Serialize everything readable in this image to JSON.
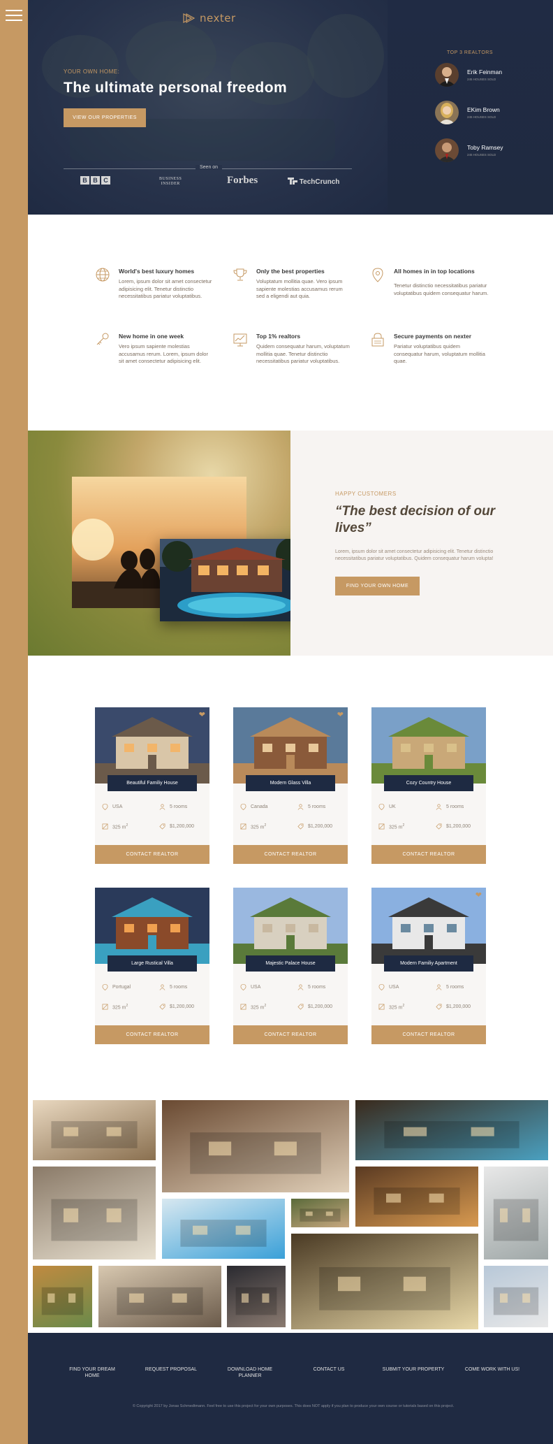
{
  "header": {
    "logo": "nexter",
    "subtitle": "YOUR OWN HOME:",
    "title": "The ultimate personal freedom",
    "cta": "VIEW OUR PROPERTIES",
    "seen_on": "Seen on",
    "brands": {
      "bbc": [
        "B",
        "B",
        "C"
      ],
      "business_insider": "BUSINESS\nINSIDER",
      "forbes": "Forbes",
      "techcrunch": "TechCrunch"
    }
  },
  "realtors": {
    "title": "TOP 3 REALTORS",
    "items": [
      {
        "name": "Erik Feinman",
        "sold": "245 HOUSES SOLD"
      },
      {
        "name": "EKim Brown",
        "sold": "245 HOUSES SOLD"
      },
      {
        "name": "Toby Ramsey",
        "sold": "245 HOUSES SOLD"
      }
    ]
  },
  "features": [
    {
      "icon": "globe-icon",
      "title": "World's best luxury homes",
      "text": "Lorem, ipsum dolor sit amet consectetur adipisicing elit. Tenetur distinctio necessitatibus pariatur voluptatibus."
    },
    {
      "icon": "trophy-icon",
      "title": "Only the best properties",
      "text": "Voluptatum mollitia quae. Vero ipsum sapiente molestias accusamus rerum sed a eligendi aut quia."
    },
    {
      "icon": "map-pin-icon",
      "title": "All homes in in top locations",
      "text": "Tenetur distinctio necessitatibus pariatur voluptatibus quidem consequatur harum."
    },
    {
      "icon": "key-icon",
      "title": "New home in one week",
      "text": "Vero ipsum sapiente molestias accusamus rerum. Lorem, ipsum dolor sit amet consectetur adipisicing elit."
    },
    {
      "icon": "chart-icon",
      "title": "Top 1% realtors",
      "text": "Quidem consequatur harum, voluptatum mollitia quae. Tenetur distinctio necessitatibus pariatur voluptatibus."
    },
    {
      "icon": "lock-icon",
      "title": "Secure payments on nexter",
      "text": "Pariatur voluptatibus quidem consequatur harum, voluptatum mollitia quae."
    }
  ],
  "story": {
    "label": "HAPPY CUSTOMERS",
    "quote": "“The best decision of our lives”",
    "text": "Lorem, ipsum dolor sit amet consectetur adipisicing elit. Tenetur distinctio necessitatibus pariatur voluptatibus. Quidem consequatur harum volupta!",
    "cta": "FIND YOUR OWN HOME"
  },
  "homes": [
    {
      "name": "Beautiful Familiy House",
      "country": "USA",
      "rooms": "5 rooms",
      "area": "325 m",
      "price": "$1,200,000",
      "cta": "CONTACT REALTOR",
      "favorite": true
    },
    {
      "name": "Modern Glass Villa",
      "country": "Canada",
      "rooms": "5 rooms",
      "area": "325 m",
      "price": "$1,200,000",
      "cta": "CONTACT REALTOR",
      "favorite": true
    },
    {
      "name": "Cozy Country House",
      "country": "UK",
      "rooms": "5 rooms",
      "area": "325 m",
      "price": "$1,200,000",
      "cta": "CONTACT REALTOR",
      "favorite": false
    },
    {
      "name": "Large Rustical Villa",
      "country": "Portugal",
      "rooms": "5 rooms",
      "area": "325 m",
      "price": "$1,200,000",
      "cta": "CONTACT REALTOR",
      "favorite": false
    },
    {
      "name": "Majestic Palace House",
      "country": "USA",
      "rooms": "5 rooms",
      "area": "325 m",
      "price": "$1,200,000",
      "cta": "CONTACT REALTOR",
      "favorite": false
    },
    {
      "name": "Modern Familiy Apartment",
      "country": "USA",
      "rooms": "5 rooms",
      "area": "325 m",
      "price": "$1,200,000",
      "cta": "CONTACT REALTOR",
      "favorite": true
    }
  ],
  "area_superscript": "2",
  "footer": {
    "nav": [
      "FIND YOUR DREAM HOME",
      "REQUEST PROPOSAL",
      "DOWNLOAD HOME PLANNER",
      "CONTACT US",
      "SUBMIT YOUR PROPERTY",
      "COME WORK WITH US!"
    ],
    "copyright": "© Copyright 2017 by Jonas Schmedtmann. Feel free to use this project for your own purposes. This does NOT apply if you plan to produce your own course or tutorials based on this project."
  },
  "colors": {
    "primary": "#c69963",
    "dark": "#1f2a42",
    "light": "#f8f6f4"
  }
}
